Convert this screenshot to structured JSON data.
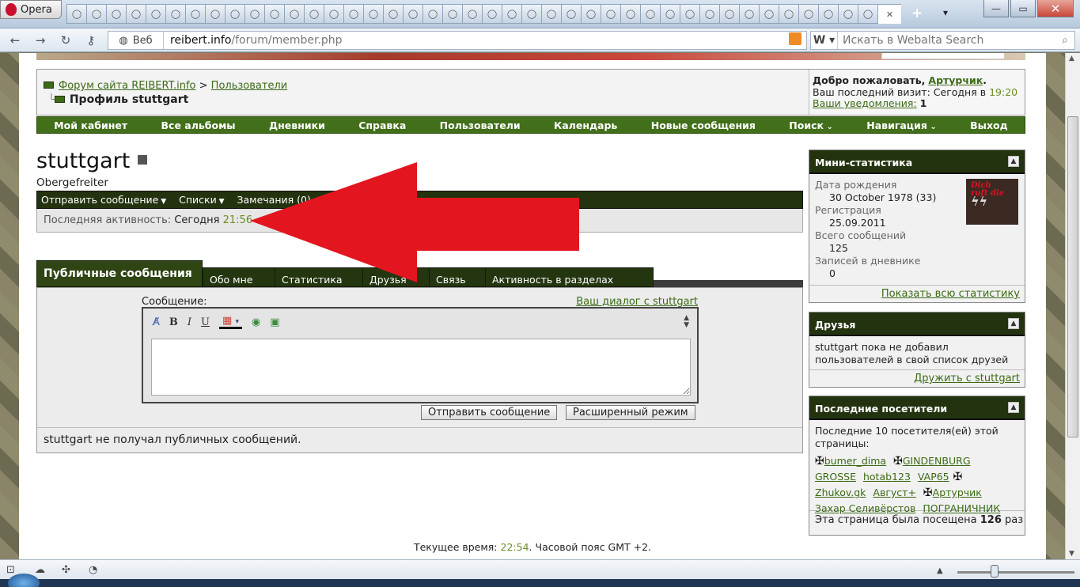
{
  "browser": {
    "menu_label": "Opera",
    "address_prefix": "Веб",
    "url_host": "reibert.info",
    "url_path": "/forum/member.php",
    "search_engine": "W",
    "search_placeholder": "Искать в Webalta Search"
  },
  "header": {
    "breadcrumb_root": "Форум сайта REIBERT.info",
    "breadcrumb_sep": ">",
    "breadcrumb_parent": "Пользователи",
    "breadcrumb_current": "Профиль stuttgart",
    "welcome_prefix": "Добро пожаловать,",
    "welcome_user": "Артурчик",
    "welcome_dot": ".",
    "last_visit_label": "Ваш последний визит: Сегодня в",
    "last_visit_time": "19:20",
    "notifications_label": "Ваши уведомления:",
    "notifications_count": "1"
  },
  "navbar": [
    "Мой кабинет",
    "Все альбомы",
    "Дневники",
    "Справка",
    "Пользователи",
    "Календарь",
    "Новые сообщения",
    "Поиск",
    "Навигация",
    "Выход"
  ],
  "profile": {
    "username": "stuttgart",
    "rank": "Obergefreiter",
    "actions": [
      "Отправить сообщение",
      "Списки",
      "Замечания (0)"
    ],
    "last_activity_label": "Последняя активность:",
    "last_activity_day": "Сегодня",
    "last_activity_time": "21:56"
  },
  "tabs": [
    "Публичные сообщения",
    "Обо мне",
    "Статистика",
    "Друзья",
    "Связь",
    "Активность в разделах"
  ],
  "message": {
    "label": "Сообщение:",
    "dialog_link": "Ваш диалог с stuttgart",
    "send_button": "Отправить сообщение",
    "advanced_button": "Расширенный режим",
    "no_messages": "stuttgart не получал публичных сообщений."
  },
  "footer": {
    "time_label": "Текущее время:",
    "time_value": "22:54",
    "timezone": ". Часовой пояс GMT +2."
  },
  "sidebar": {
    "stats": {
      "title": "Мини-статистика",
      "birth_label": "Дата рождения",
      "birth_value": "30 October 1978 (33)",
      "reg_label": "Регистрация",
      "reg_value": "25.09.2011",
      "posts_label": "Всего сообщений",
      "posts_value": "125",
      "diary_label": "Записей в дневнике",
      "diary_value": "0",
      "more_link": "Показать всю статистику"
    },
    "friends": {
      "title": "Друзья",
      "text": "stuttgart пока не добавил пользователей в свой список друзей",
      "link": "Дружить с stuttgart"
    },
    "visitors": {
      "title": "Последние посетители",
      "intro": "Последние 10 посетителя(ей) этой страницы:",
      "names": [
        "bumer_dima",
        "GINDENBURG",
        "GROSSE",
        "hotab123",
        "VAP65",
        "Zhukov.gk",
        "Август+",
        "Артурчик",
        "Захар Селивёрстов",
        "ПОГРАНИЧНИК"
      ],
      "visited_prefix": "Эта страница была посещена",
      "visited_count": "126",
      "visited_suffix": "раз"
    }
  },
  "colors": {
    "forum_green": "#426f1a",
    "dark_green": "#23330f",
    "link_green": "#3c6b16",
    "time_green": "#6b8e23",
    "arrow_red": "#e3161f"
  }
}
